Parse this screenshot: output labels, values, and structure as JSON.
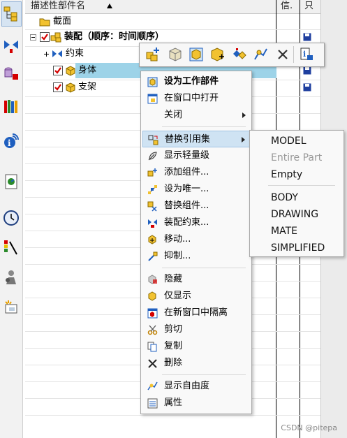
{
  "header": {
    "col_name": "描述性部件名",
    "col_info": "信.",
    "col_extra": "只"
  },
  "tree": {
    "section": "截面",
    "assembly": "装配（顺序：时间顺序）",
    "constraints": "约束",
    "part_body": "身体",
    "part_support": "支架"
  },
  "menu": {
    "items": [
      {
        "label": "设为工作部件",
        "icon": "work-part-icon",
        "bold": true
      },
      {
        "label": "在窗口中打开",
        "icon": "open-window-icon"
      },
      {
        "label": "关闭",
        "icon": "",
        "submenu": true
      },
      {
        "label": "替换引用集",
        "icon": "replace-refset-icon",
        "submenu": true,
        "highlighted": true
      },
      {
        "label": "显示轻量级",
        "icon": "lightweight-icon"
      },
      {
        "label": "添加组件...",
        "icon": "add-component-icon"
      },
      {
        "label": "设为唯一...",
        "icon": "make-unique-icon"
      },
      {
        "label": "替换组件...",
        "icon": "replace-component-icon"
      },
      {
        "label": "装配约束...",
        "icon": "assembly-constraint-icon"
      },
      {
        "label": "移动...",
        "icon": "move-icon"
      },
      {
        "label": "抑制...",
        "icon": "suppress-icon"
      },
      {
        "label": "隐藏",
        "icon": "hide-icon"
      },
      {
        "label": "仅显示",
        "icon": "show-only-icon"
      },
      {
        "label": "在新窗口中隔离",
        "icon": "isolate-icon"
      },
      {
        "label": "剪切",
        "icon": "cut-icon"
      },
      {
        "label": "复制",
        "icon": "copy-icon"
      },
      {
        "label": "删除",
        "icon": "delete-icon"
      },
      {
        "label": "显示自由度",
        "icon": "dof-icon"
      },
      {
        "label": "属性",
        "icon": "properties-icon"
      }
    ]
  },
  "submenu": {
    "items": [
      {
        "label": "MODEL",
        "disabled": false
      },
      {
        "label": "Entire Part",
        "disabled": true
      },
      {
        "label": "Empty",
        "disabled": false
      },
      {
        "label": "BODY",
        "disabled": false
      },
      {
        "label": "DRAWING",
        "disabled": false
      },
      {
        "label": "MATE",
        "disabled": false
      },
      {
        "label": "SIMPLIFIED",
        "disabled": false
      }
    ]
  },
  "watermark": "CSDN @pitepa",
  "colors": {
    "selection": "#9dd3e8",
    "menu_highlight": "#cfe3f3",
    "checkbox_red": "#d40000",
    "part_yellow": "#f2c230"
  }
}
